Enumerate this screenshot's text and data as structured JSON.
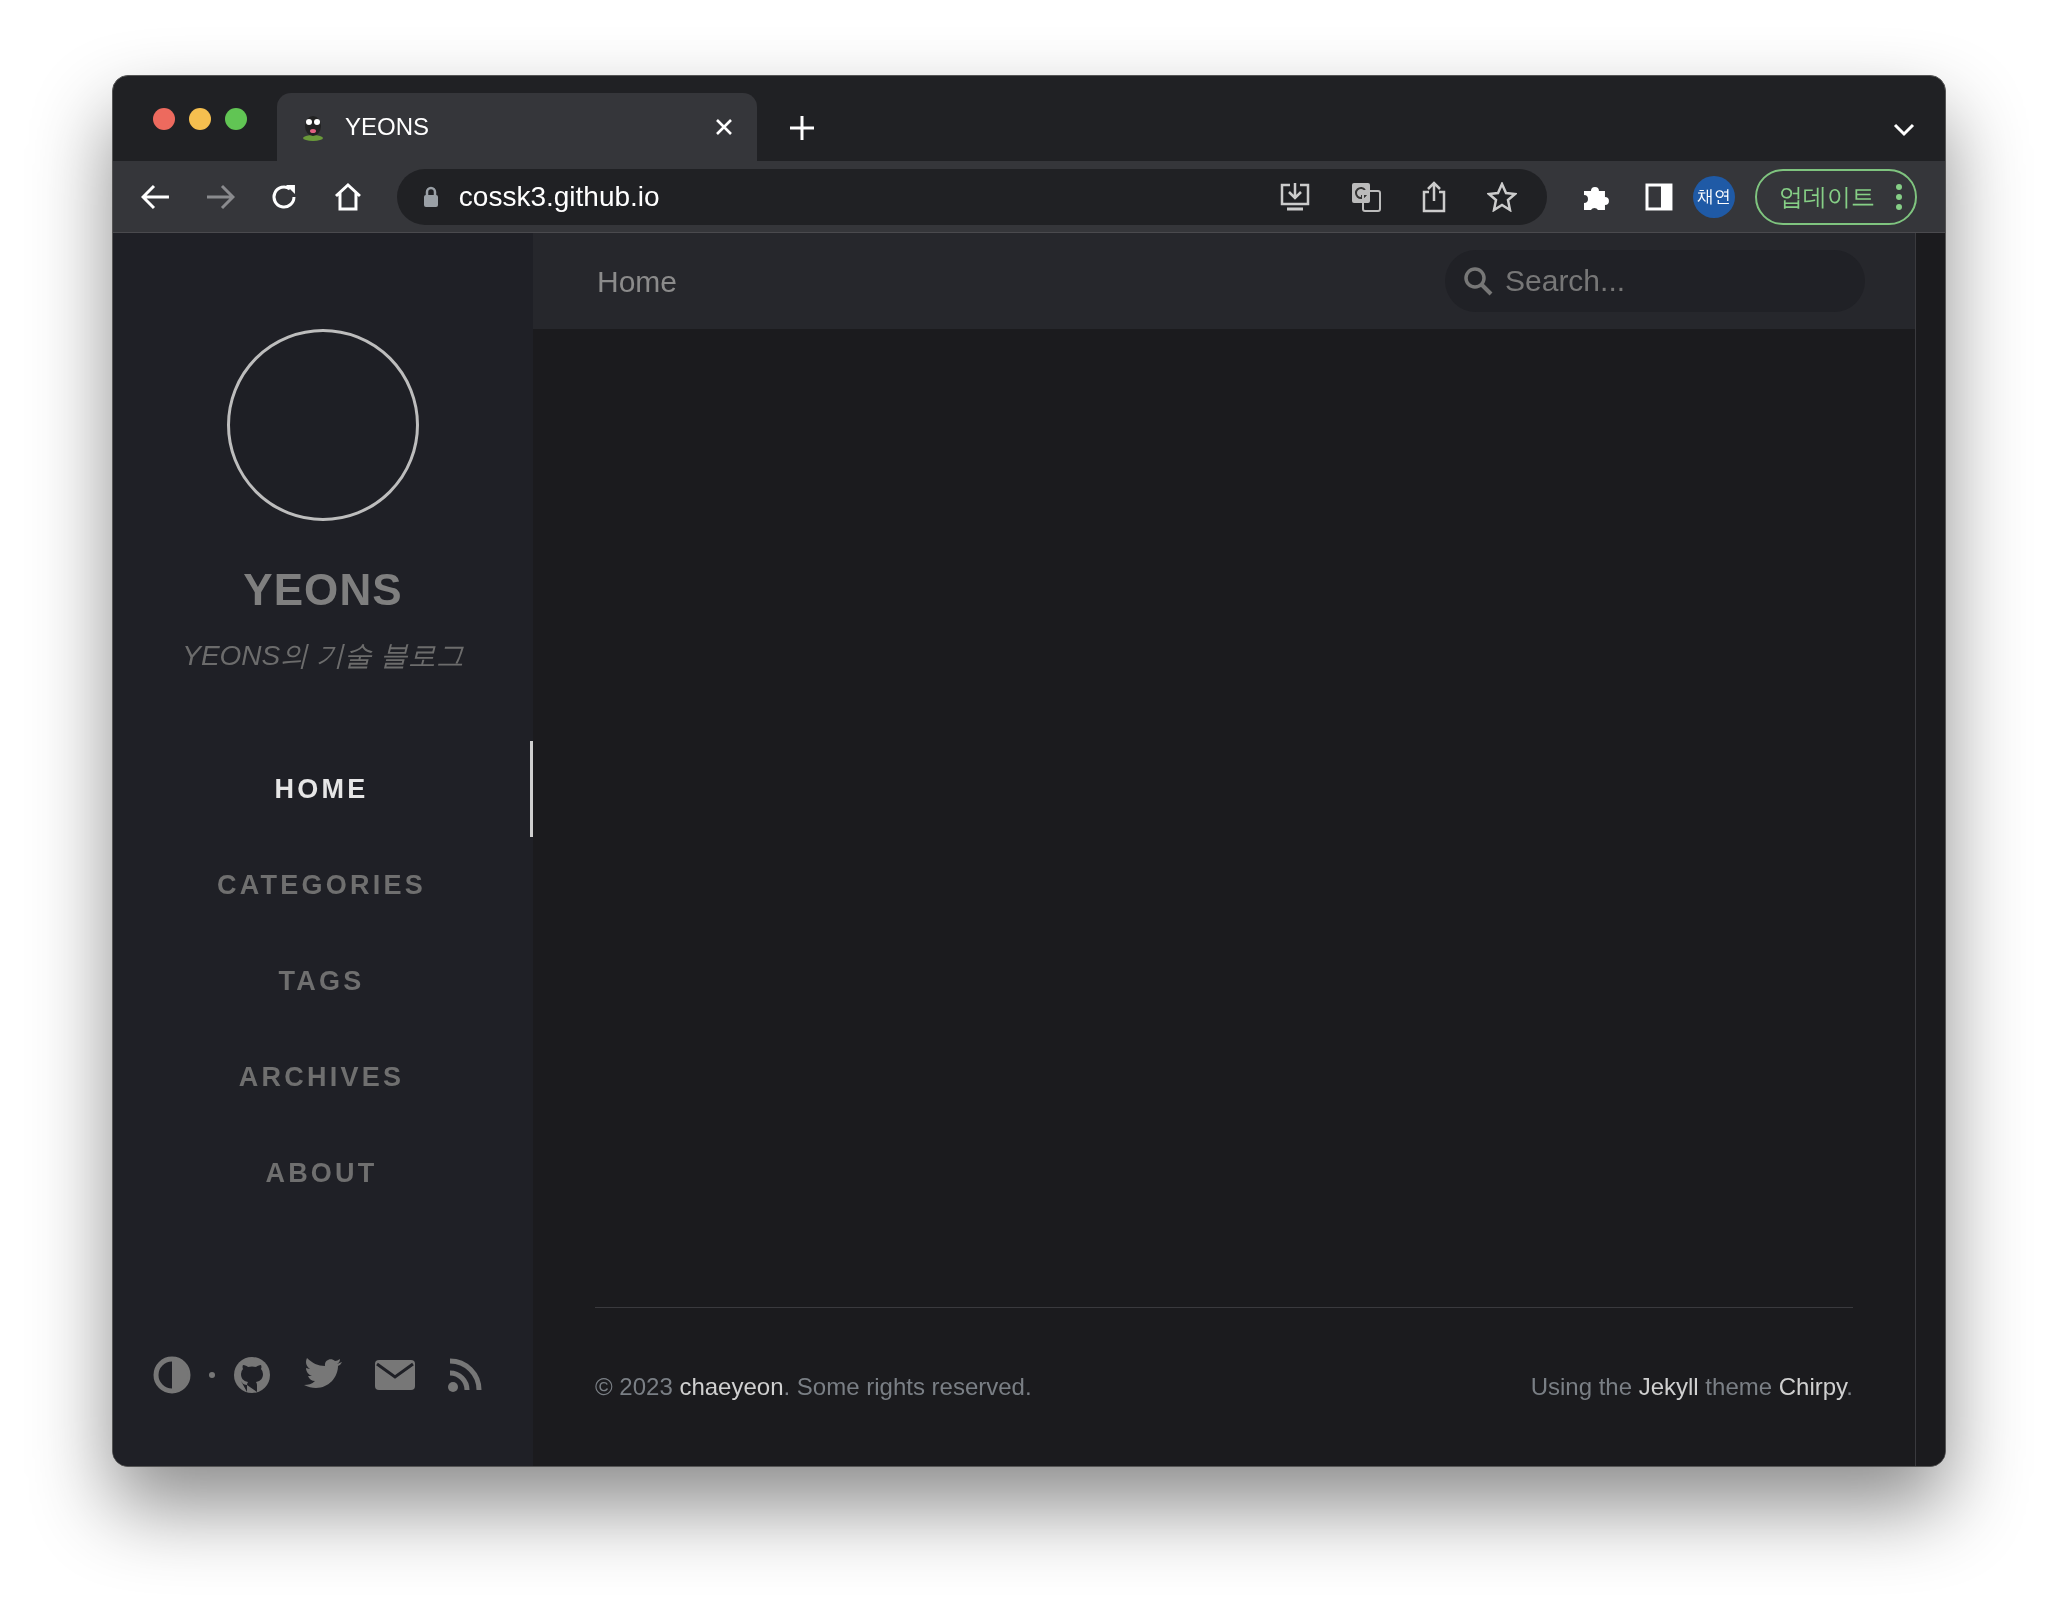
{
  "browser": {
    "tab": {
      "title": "YEONS",
      "selected": true
    },
    "url": "cossk3.github.io",
    "profile": "채연",
    "update_button": "업데이트"
  },
  "sidebar": {
    "title": "YEONS",
    "subtitle": "YEONS의 기술 블로그",
    "nav": [
      {
        "label": "HOME",
        "selected": true
      },
      {
        "label": "CATEGORIES",
        "selected": false
      },
      {
        "label": "TAGS",
        "selected": false
      },
      {
        "label": "ARCHIVES",
        "selected": false
      },
      {
        "label": "ABOUT",
        "selected": false
      }
    ]
  },
  "topbar": {
    "breadcrumb": "Home",
    "search": {
      "placeholder": "Search..."
    }
  },
  "footer": {
    "left": [
      {
        "text": "© 2023 ",
        "link": false
      },
      {
        "text": "chaeyeon",
        "link": true
      },
      {
        "text": ". Some rights reserved.",
        "link": false
      }
    ],
    "right": [
      {
        "text": "Using the ",
        "link": false
      },
      {
        "text": "Jekyll",
        "link": true
      },
      {
        "text": " theme ",
        "link": false
      },
      {
        "text": "Chirpy",
        "link": true
      },
      {
        "text": ".",
        "link": false
      }
    ]
  }
}
